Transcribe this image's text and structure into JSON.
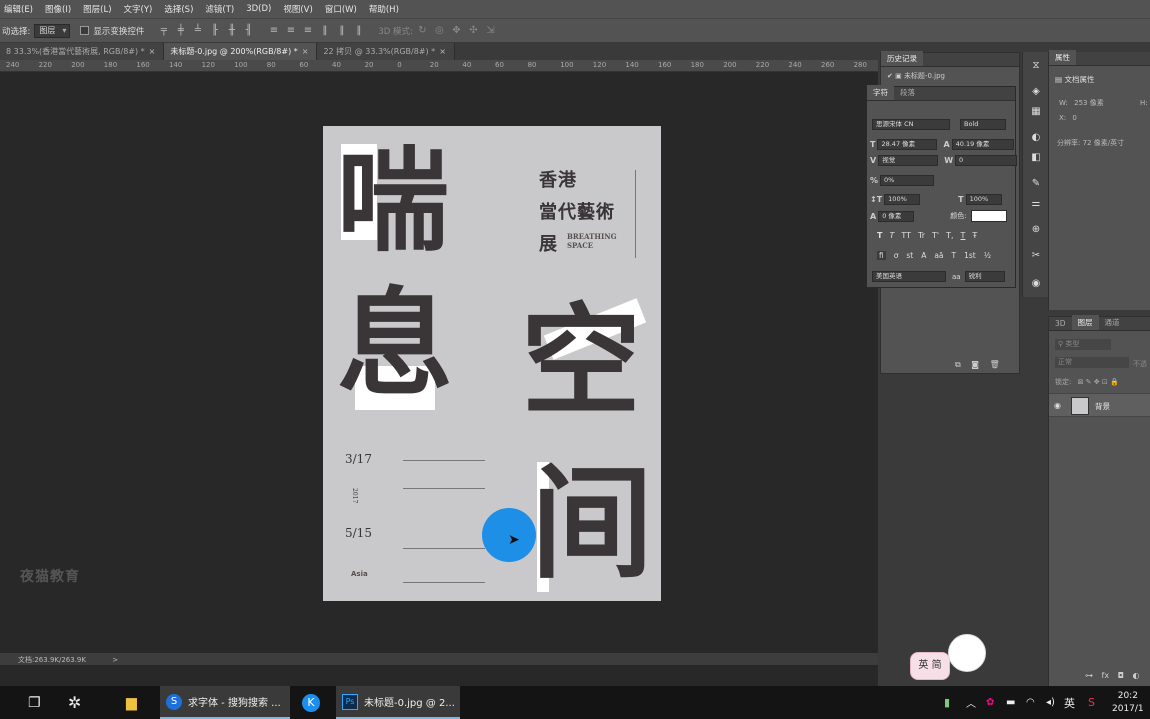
{
  "menu": [
    "编辑(E)",
    "图像(I)",
    "图层(L)",
    "文字(Y)",
    "选择(S)",
    "滤镜(T)",
    "3D(D)",
    "视图(V)",
    "窗口(W)",
    "帮助(H)"
  ],
  "options": {
    "auto_select_label": "动选择:",
    "auto_select_value": "图层",
    "show_transform_label": "显示变换控件",
    "mode3d_label": "3D 模式:"
  },
  "tabs": [
    {
      "label": "8 33.3%(香港當代藝術展, RGB/8#) *",
      "active": false
    },
    {
      "label": "未标题-0.jpg @ 200%(RGB/8#) *",
      "active": true
    },
    {
      "label": "22 拷贝 @ 33.3%(RGB/8#) *",
      "active": false
    }
  ],
  "ruler_ticks": [
    "240",
    "220",
    "200",
    "180",
    "160",
    "140",
    "120",
    "100",
    "80",
    "60",
    "40",
    "20",
    "0",
    "20",
    "40",
    "60",
    "80",
    "100",
    "120",
    "140",
    "160",
    "180",
    "200",
    "220",
    "240",
    "260",
    "280"
  ],
  "poster": {
    "chars": [
      "喘",
      "息",
      "空",
      "间"
    ],
    "title_lines": [
      "香港",
      "當代藝術",
      "展"
    ],
    "subtitle_en": "BREATHING SPACE",
    "date_start": "3/17",
    "year": "2017",
    "date_end": "5/15",
    "logo": "Asia"
  },
  "watermark": "夜猫教育",
  "status": {
    "doc": "文档:263.9K/263.9K",
    "arrow": ">"
  },
  "history_panel": {
    "title": "历史记录",
    "item": "未标题-0.jpg"
  },
  "char_panel": {
    "tabs": [
      "字符",
      "段落"
    ],
    "font_family": "思源宋体 CN",
    "font_style": "Bold",
    "font_size": "28.47 像素",
    "leading": "40.19 像素",
    "kerning": "视觉",
    "tracking": "0",
    "scale_percent": "0%",
    "vscale": "100%",
    "hscale": "100%",
    "baseline": "0 像素",
    "color_label": "颜色:",
    "style_buttons": [
      "T",
      "T",
      "TT",
      "Tr",
      "T'",
      "T,",
      "T",
      "Ŧ"
    ],
    "ot_buttons": [
      "fi",
      "ơ",
      "st",
      "A",
      "aā",
      "T",
      "1st",
      "½"
    ],
    "language": "美国英语",
    "aa_label": "aa",
    "antialias": "锐利"
  },
  "props_panel": {
    "tab": "属性",
    "doc_props": "文档属性",
    "w_label": "W:",
    "w_value": "253 像素",
    "h_label": "H:",
    "x_label": "X:",
    "x_value": "0",
    "resolution": "分辨率: 72 像素/英寸"
  },
  "layers_panel": {
    "tabs": [
      "3D",
      "图层",
      "通道"
    ],
    "kind_placeholder": "类型",
    "blend_mode": "正常",
    "opacity_label": "不透",
    "lock_label": "锁定:",
    "layer_name": "背景"
  },
  "taskbar": {
    "app1": "求字体 - 搜狗搜索 ...",
    "app2": "未标题-0.jpg @ 2...",
    "ime": "英",
    "time": "20:2",
    "date": "2017/1"
  },
  "mascot_text": "英 简"
}
